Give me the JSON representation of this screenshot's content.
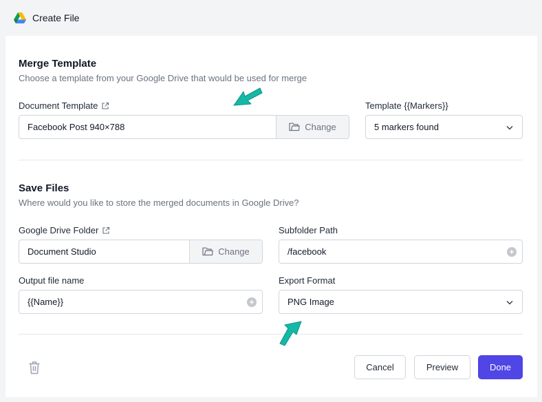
{
  "app": {
    "title": "Create File",
    "logo_icon": "google-drive-icon"
  },
  "merge_template": {
    "heading": "Merge Template",
    "description": "Choose a template from your Google Drive that would be used for merge",
    "document_template": {
      "label": "Document Template",
      "value": "Facebook Post 940×788",
      "change_label": "Change"
    },
    "markers": {
      "label": "Template {{Markers}}",
      "value": "5 markers found"
    }
  },
  "save_files": {
    "heading": "Save Files",
    "description": "Where would you like to store the merged documents in Google Drive?",
    "drive_folder": {
      "label": "Google Drive Folder",
      "value": "Document Studio",
      "change_label": "Change"
    },
    "subfolder": {
      "label": "Subfolder Path",
      "value": "/facebook"
    },
    "output_name": {
      "label": "Output file name",
      "value": "{{Name}}"
    },
    "export_format": {
      "label": "Export Format",
      "value": "PNG Image"
    }
  },
  "footer": {
    "cancel_label": "Cancel",
    "preview_label": "Preview",
    "done_label": "Done"
  },
  "colors": {
    "accent": "#4f46e5",
    "annotation_arrow": "#14b8a6"
  }
}
